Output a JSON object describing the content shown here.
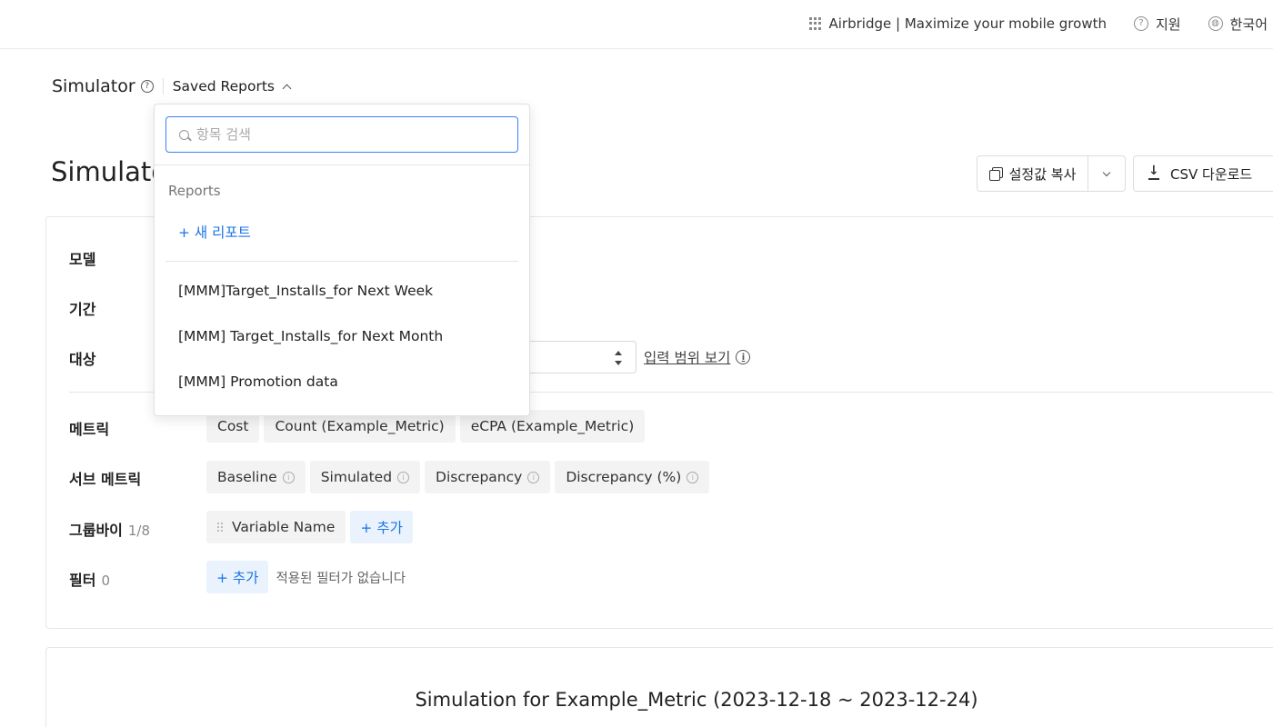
{
  "topbar": {
    "brand_text": "Airbridge | Maximize your mobile growth",
    "support_label": "지원",
    "language_label": "한국어"
  },
  "breadcrumb": {
    "title": "Simulator",
    "saved_reports_label": "Saved Reports"
  },
  "page": {
    "title": "Simulator"
  },
  "actions": {
    "copy_settings_label": "설정값 복사",
    "csv_download_label": "CSV 다운로드"
  },
  "settings": {
    "model_label": "모델",
    "period_label": "기간",
    "target_label": "대상",
    "input_range_link": "입력 범위 보기",
    "metric_label": "메트릭",
    "metrics": [
      "Cost",
      "Count (Example_Metric)",
      "eCPA (Example_Metric)"
    ],
    "submetric_label": "서브 메트릭",
    "submetrics": [
      "Baseline",
      "Simulated",
      "Discrepancy",
      "Discrepancy (%)"
    ],
    "groupby_label": "그룹바이",
    "groupby_count": "1/8",
    "groupby_items": [
      "Variable Name"
    ],
    "add_label": "+ 추가",
    "filter_label": "필터",
    "filter_count": "0",
    "filter_empty_text": "적용된 필터가 없습니다"
  },
  "simulation": {
    "title": "Simulation for Example_Metric (2023-12-18 ~ 2023-12-24)"
  },
  "dropdown": {
    "search_placeholder": "항목 검색",
    "section_label": "Reports",
    "new_report_label": "+ 새 리포트",
    "reports": [
      "[MMM]Target_Installs_for Next Week",
      "[MMM] Target_Installs_for Next Month",
      "[MMM] Promotion data"
    ]
  },
  "colors": {
    "accent": "#1a73e8",
    "focus_border": "#3b82f6",
    "chip_bg": "#f3f3f3",
    "add_chip_bg": "#eaf3fd"
  }
}
